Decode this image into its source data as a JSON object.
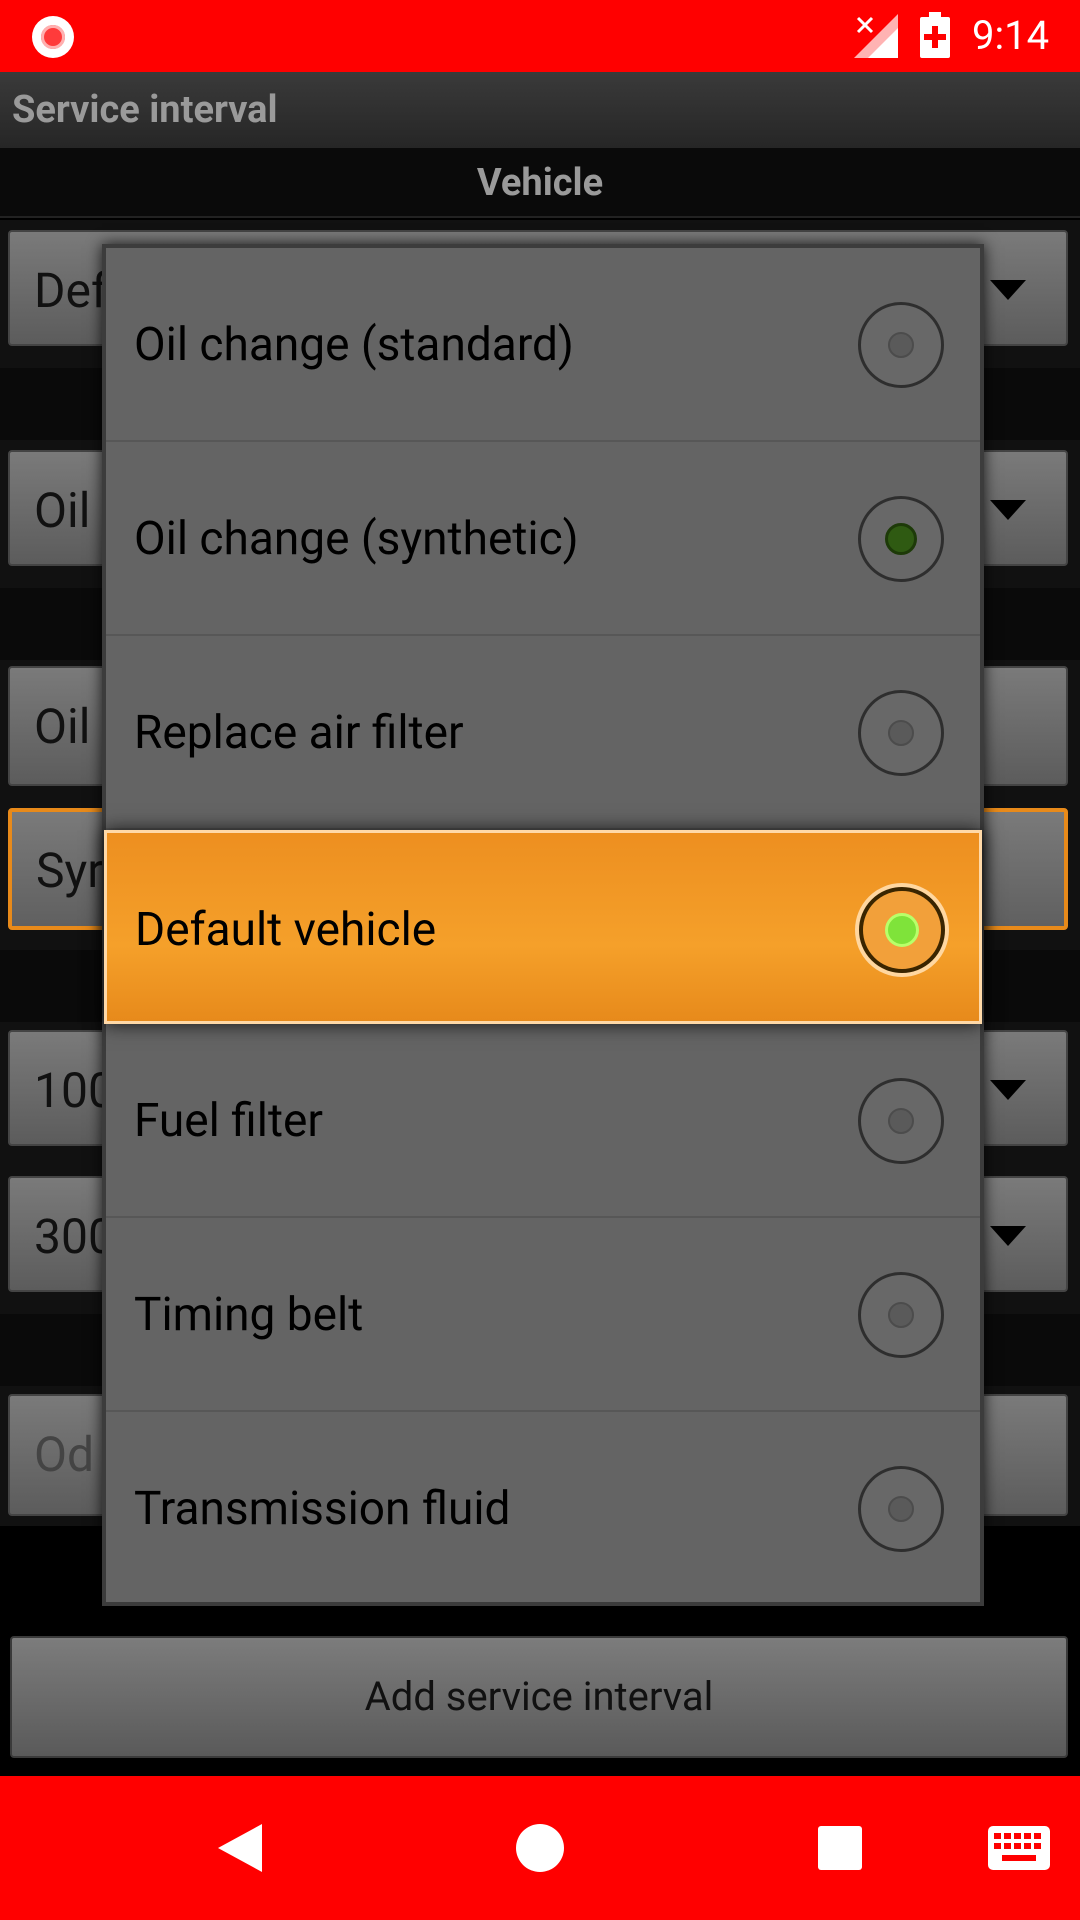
{
  "status_bar": {
    "time": "9:14"
  },
  "app_bar": {
    "title": "Service interval"
  },
  "section": {
    "vehicle_header": "Vehicle"
  },
  "form": {
    "vehicle_spinner": "Def",
    "service_spinner": "Oil",
    "name_field": "Oil",
    "description_field": "Syr",
    "interval_distance_spinner": "100",
    "interval_time_spinner": "300",
    "odometer_field_placeholder": "Od"
  },
  "dialog": {
    "options": [
      {
        "label": "Oil change (standard)",
        "state": "unchecked"
      },
      {
        "label": "Oil change (synthetic)",
        "state": "checked"
      },
      {
        "label": "Replace air filter",
        "state": "unchecked"
      },
      {
        "label": "Default vehicle",
        "state": "selected"
      },
      {
        "label": "Fuel filter",
        "state": "unchecked"
      },
      {
        "label": "Timing belt",
        "state": "unchecked"
      },
      {
        "label": "Transmission fluid",
        "state": "unchecked"
      }
    ]
  },
  "buttons": {
    "add_service_interval": "Add service interval"
  },
  "colors": {
    "status_bar": "#ff0000",
    "nav_bar": "#ff0000",
    "highlight": "#f39a26",
    "radio_checked": "#2f5a12",
    "radio_selected": "#7fe33a"
  }
}
